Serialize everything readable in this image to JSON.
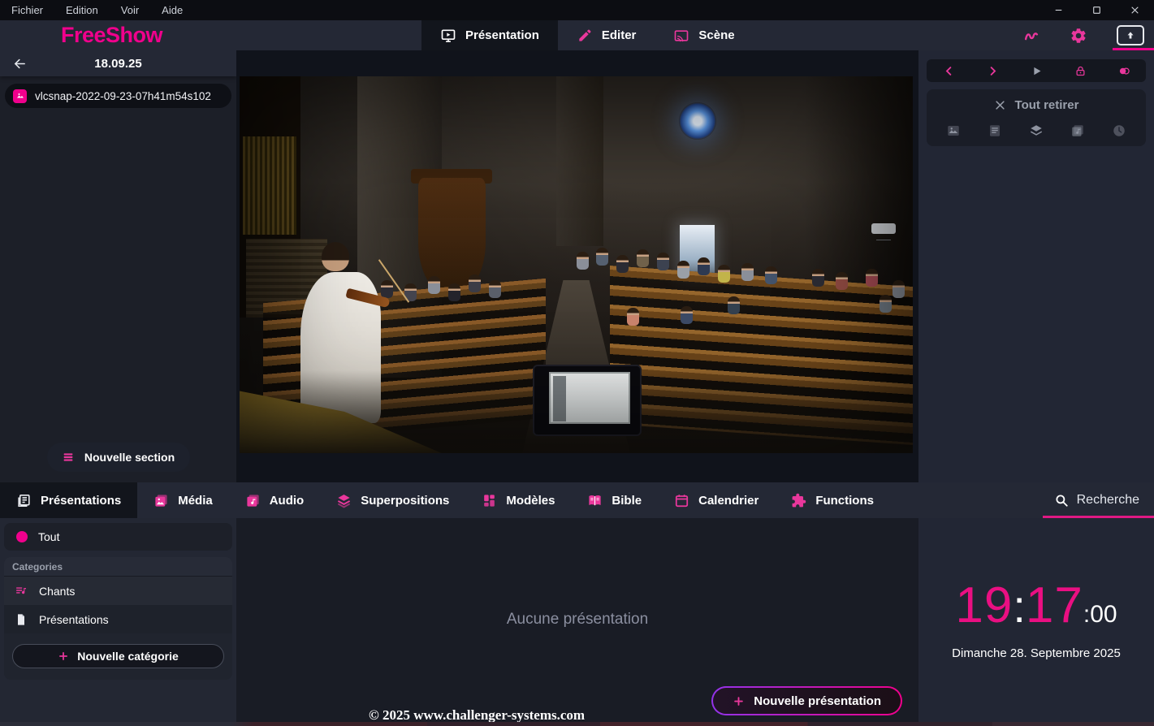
{
  "titlebar": {
    "menu": [
      {
        "label": "Fichier"
      },
      {
        "label": "Edition"
      },
      {
        "label": "Voir"
      },
      {
        "label": "Aide"
      }
    ]
  },
  "header": {
    "logo": "FreeShow",
    "tabs": [
      {
        "label": "Présentation"
      },
      {
        "label": "Editer"
      },
      {
        "label": "Scène"
      }
    ]
  },
  "project_panel": {
    "date": "18.09.25",
    "items": [
      {
        "label": "vlcsnap-2022-09-23-07h41m54s102"
      }
    ],
    "new_section_label": "Nouvelle section"
  },
  "output_panel": {
    "clear_all_label": "Tout retirer"
  },
  "drawer_tabs": [
    {
      "label": "Présentations"
    },
    {
      "label": "Média"
    },
    {
      "label": "Audio"
    },
    {
      "label": "Superpositions"
    },
    {
      "label": "Modèles"
    },
    {
      "label": "Bible"
    },
    {
      "label": "Calendrier"
    },
    {
      "label": "Functions"
    }
  ],
  "search": {
    "label": "Recherche"
  },
  "categories_panel": {
    "all_label": "Tout",
    "header": "Categories",
    "items": [
      {
        "label": "Chants"
      },
      {
        "label": "Présentations"
      }
    ],
    "new_category_label": "Nouvelle catégorie"
  },
  "content_panel": {
    "empty_label": "Aucune présentation",
    "new_presentation_label": "Nouvelle présentation",
    "watermark": "© 2025 www.challenger-systems.com"
  },
  "clock": {
    "hours": "19",
    "colon": ":",
    "minutes": "17",
    "seconds": ":00",
    "date": "Dimanche 28. Septembre 2025"
  },
  "icons": [
    "presentation-icon",
    "edit-icon",
    "stage-icon",
    "draw-icon",
    "settings-icon",
    "output-icon",
    "minimize-icon",
    "maximize-icon",
    "close-icon",
    "back-icon",
    "image-icon",
    "menu-icon",
    "chevron-left-icon",
    "chevron-right-icon",
    "play-icon",
    "lock-icon",
    "toggle-icon",
    "clear-icon",
    "media-icon",
    "text-icon",
    "layers-icon",
    "music-icon",
    "clock-icon",
    "circle-icon",
    "playlist-icon",
    "document-icon",
    "plus-icon",
    "search-icon",
    "templates-icon",
    "bible-icon",
    "calendar-icon",
    "puzzle-icon"
  ],
  "colors": {
    "accent": "#f0008c",
    "accent_soft": "#e9379c",
    "purple": "#9333ea"
  }
}
